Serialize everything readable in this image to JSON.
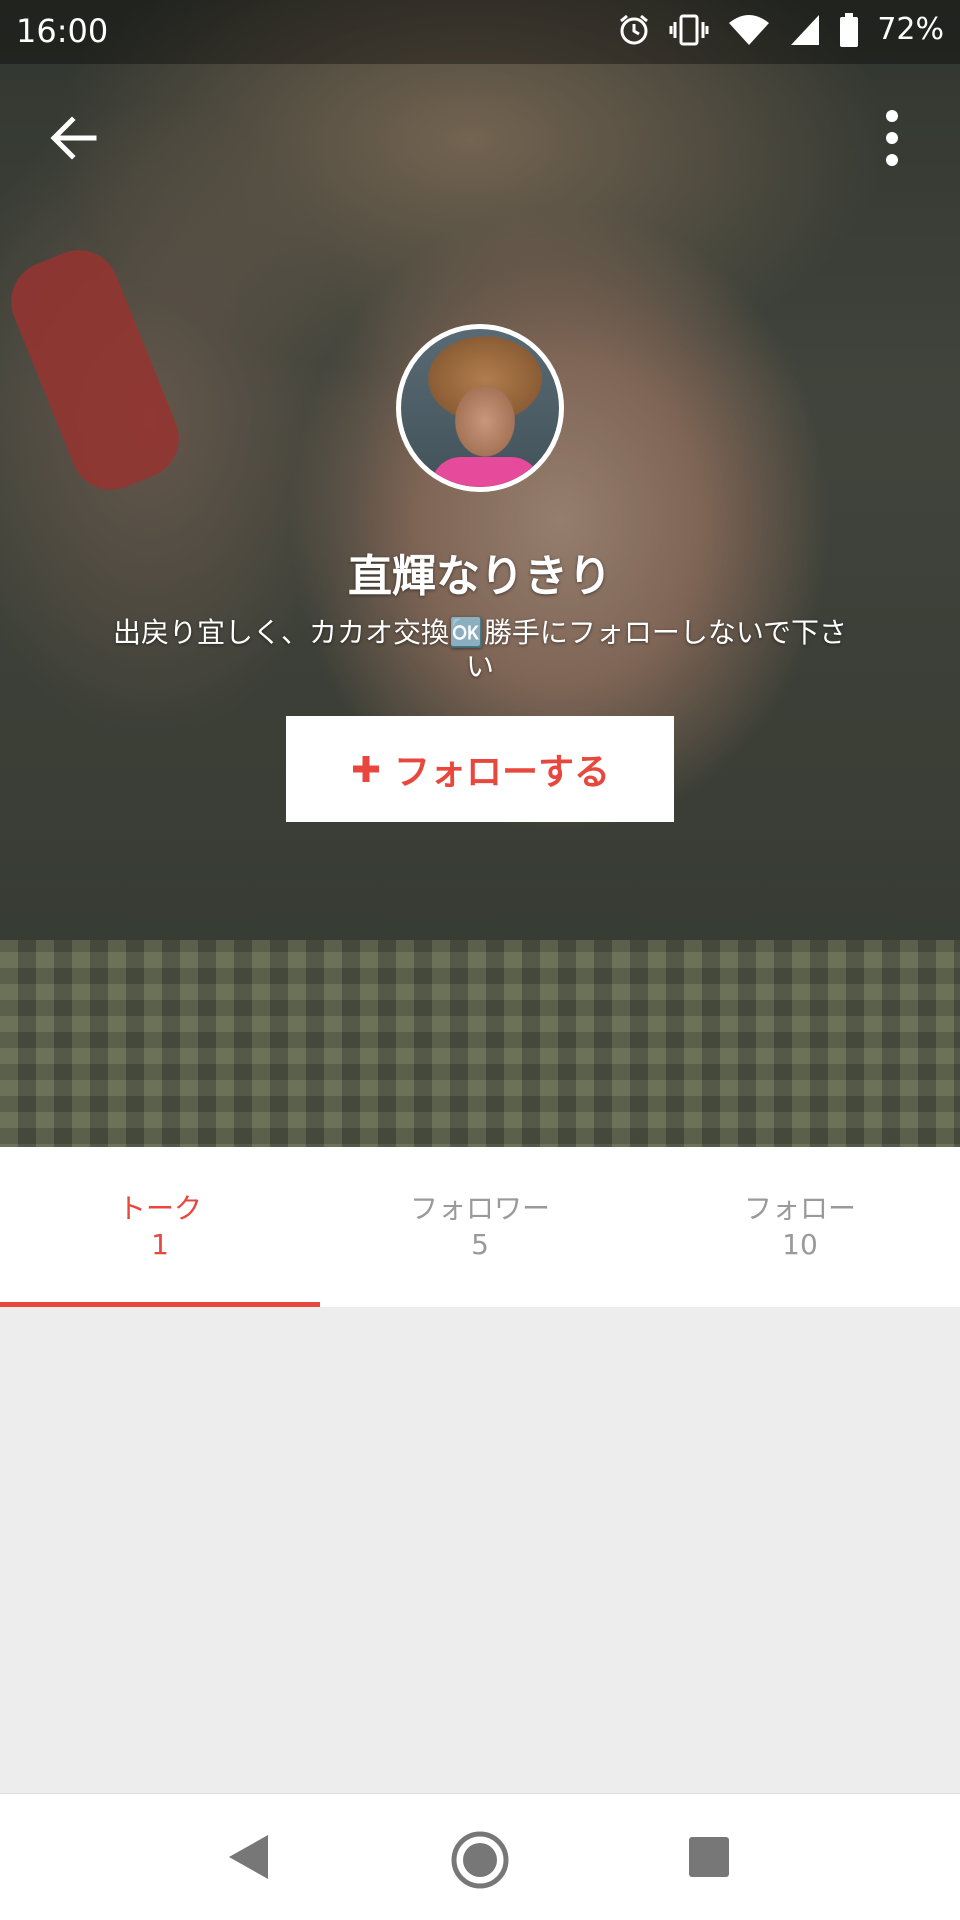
{
  "status_bar": {
    "time": "16:00",
    "battery": "72%",
    "icons": [
      "alarm-icon",
      "vibrate-icon",
      "wifi-icon",
      "signal-icon",
      "battery-icon"
    ]
  },
  "app_bar": {
    "back_icon": "arrow-left-icon",
    "menu_icon": "more-vertical-icon"
  },
  "profile": {
    "name": "直輝なりきり",
    "bio": "出戻り宜しく、カカオ交換🆗勝手にフォローしないで下さい",
    "follow_button": {
      "icon": "plus-icon",
      "label": "フォローする"
    }
  },
  "tabs": [
    {
      "label": "トーク",
      "count": "1",
      "active": true
    },
    {
      "label": "フォロワー",
      "count": "5",
      "active": false
    },
    {
      "label": "フォロー",
      "count": "10",
      "active": false
    }
  ],
  "nav_bar": {
    "icons": [
      "nav-back-icon",
      "nav-home-icon",
      "nav-recents-icon"
    ]
  },
  "colors": {
    "accent": "#e8473d",
    "tab_inactive": "#9a9a9a",
    "background": "#ededed"
  }
}
